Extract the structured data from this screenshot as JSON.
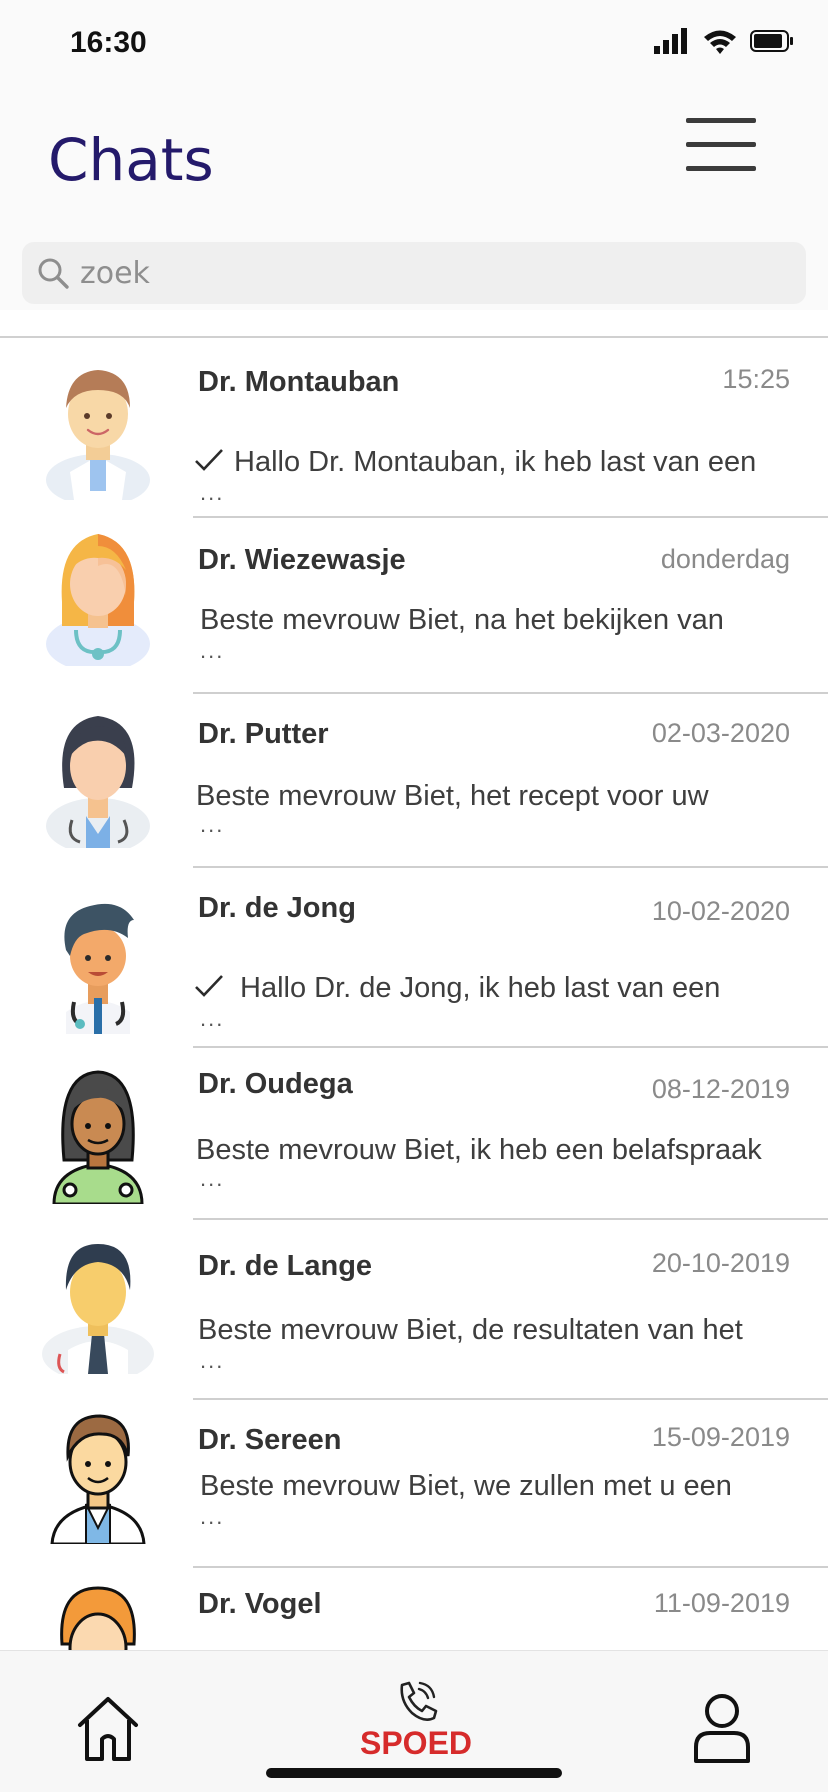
{
  "status_bar": {
    "time": "16:30"
  },
  "header": {
    "title": "Chats"
  },
  "search": {
    "placeholder": "zoek"
  },
  "chats": [
    {
      "name": "Dr. Montauban",
      "date": "15:25",
      "preview": "Hallo Dr. Montauban, ik heb last van een",
      "ellipsis": "...",
      "read_check": true
    },
    {
      "name": "Dr. Wiezewasje",
      "date": "donderdag",
      "preview": "Beste mevrouw Biet, na het bekijken van",
      "ellipsis": "...",
      "read_check": false
    },
    {
      "name": "Dr. Putter",
      "date": "02-03-2020",
      "preview": "Beste mevrouw Biet, het recept voor uw",
      "ellipsis": "...",
      "read_check": false
    },
    {
      "name": "Dr. de Jong",
      "date": "10-02-2020",
      "preview": "Hallo Dr. de Jong, ik heb last van een",
      "ellipsis": "...",
      "read_check": true
    },
    {
      "name": "Dr. Oudega",
      "date": "08-12-2019",
      "preview": "Beste mevrouw Biet, ik heb een belafspraak",
      "ellipsis": "...",
      "read_check": false
    },
    {
      "name": "Dr. de Lange",
      "date": "20-10-2019",
      "preview": "Beste mevrouw Biet, de resultaten van het",
      "ellipsis": "...",
      "read_check": false
    },
    {
      "name": "Dr. Sereen",
      "date": "15-09-2019",
      "preview": "Beste mevrouw Biet, we zullen met u een",
      "ellipsis": "...",
      "read_check": false
    },
    {
      "name": "Dr. Vogel",
      "date": "11-09-2019",
      "preview": "",
      "ellipsis": "",
      "read_check": false
    }
  ],
  "tab_bar": {
    "spoed_label": "SPOED"
  },
  "icons": {
    "status": [
      "signal-icon",
      "wifi-icon",
      "battery-icon"
    ],
    "header": [
      "menu-icon"
    ],
    "search": "search-icon",
    "tabs": [
      "home-icon",
      "phone-icon",
      "profile-icon"
    ],
    "read": "check-icon"
  },
  "colors": {
    "title": "#241a6b",
    "spoed": "#d62b2b",
    "background": "#fafafa"
  }
}
